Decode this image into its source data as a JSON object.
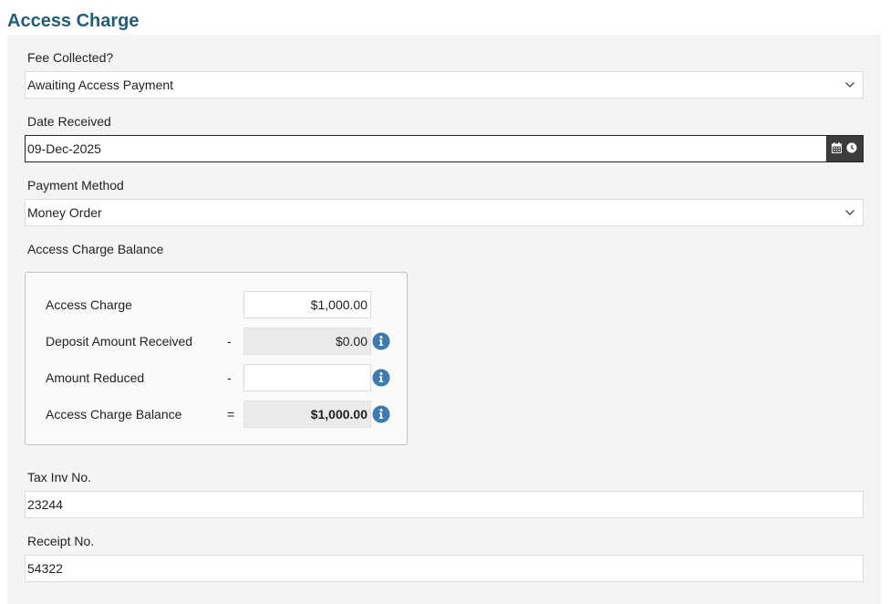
{
  "page": {
    "title": "Access Charge"
  },
  "fee_collected": {
    "label": "Fee Collected?",
    "value": "Awaiting Access Payment"
  },
  "date_received": {
    "label": "Date Received",
    "value": "09-Dec-2025",
    "icons": [
      "calendar-icon",
      "clock-icon"
    ]
  },
  "payment_method": {
    "label": "Payment Method",
    "value": "Money Order"
  },
  "balance_section": {
    "label": "Access Charge Balance",
    "rows": [
      {
        "label": "Access Charge",
        "operator": "",
        "value": "$1,000.00"
      },
      {
        "label": "Deposit Amount Received",
        "operator": "-",
        "value": "$0.00"
      },
      {
        "label": "Amount Reduced",
        "operator": "-",
        "value": ""
      },
      {
        "label": "Access Charge Balance",
        "operator": "=",
        "value": "$1,000.00"
      }
    ]
  },
  "tax_inv": {
    "label": "Tax Inv No.",
    "value": "23244"
  },
  "receipt": {
    "label": "Receipt No.",
    "value": "54322"
  },
  "colors": {
    "title": "#1d5f7a",
    "info_icon": "#3d7cb0",
    "date_button_bg": "#3c3c3c",
    "panel_bg": "#f4f4f4"
  }
}
